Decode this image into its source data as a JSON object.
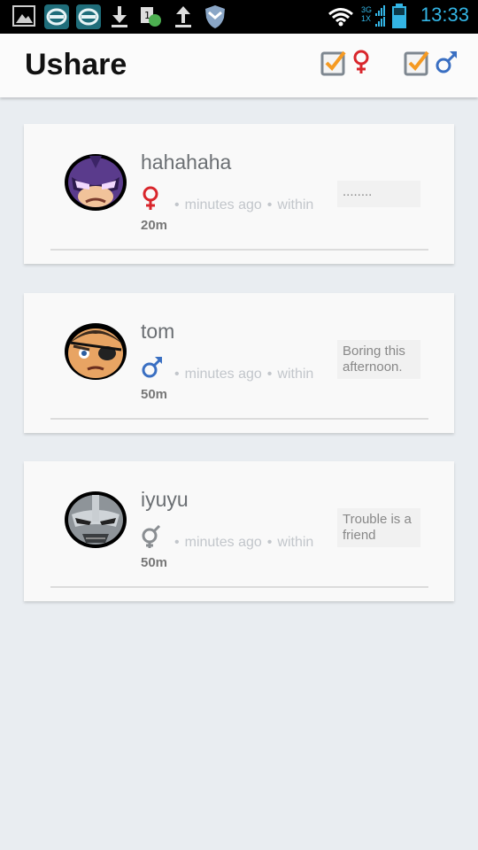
{
  "statusbar": {
    "time": "13:33",
    "network_top": "3G",
    "network_bottom": "1X"
  },
  "header": {
    "title": "Ushare",
    "filters": [
      {
        "name": "female-filter",
        "icon": "female-symbol-icon",
        "color": "#d9262c"
      },
      {
        "name": "male-filter",
        "icon": "male-symbol-icon",
        "color": "#3a6fc2"
      }
    ]
  },
  "posts": [
    {
      "username": "hahahaha",
      "gender_icon": "female-symbol-icon",
      "time_text": "minutes ago",
      "within_text": "within",
      "distance": "20m",
      "status": "........",
      "avatar_icon": "hawkeye-avatar-icon"
    },
    {
      "username": "tom",
      "gender_icon": "male-symbol-icon",
      "time_text": "minutes ago",
      "within_text": "within",
      "distance": "50m",
      "status": "Boring this afternoon.",
      "avatar_icon": "nick-fury-avatar-icon"
    },
    {
      "username": "iyuyu",
      "gender_icon": "unknown-gender-icon",
      "time_text": "minutes ago",
      "within_text": "within",
      "distance": "50m",
      "status": "Trouble is a friend",
      "avatar_icon": "war-machine-avatar-icon"
    }
  ]
}
